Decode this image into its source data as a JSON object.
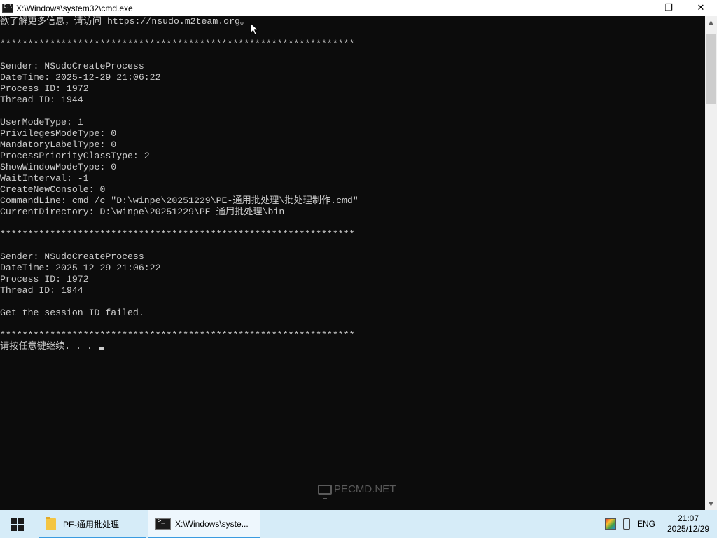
{
  "window": {
    "title": "X:\\Windows\\system32\\cmd.exe",
    "minimize_glyph": "—",
    "restore_glyph": "❐",
    "close_glyph": "✕"
  },
  "console": {
    "lines": [
      "欲了解更多信息，请访问 https://nsudo.m2team.org。",
      "",
      "****************************************************************",
      "",
      "Sender: NSudoCreateProcess",
      "DateTime: 2025-12-29 21:06:22",
      "Process ID: 1972",
      "Thread ID: 1944",
      "",
      "UserModeType: 1",
      "PrivilegesModeType: 0",
      "MandatoryLabelType: 0",
      "ProcessPriorityClassType: 2",
      "ShowWindowModeType: 0",
      "WaitInterval: -1",
      "CreateNewConsole: 0",
      "CommandLine: cmd /c \"D:\\winpe\\20251229\\PE-通用批处理\\批处理制作.cmd\"",
      "CurrentDirectory: D:\\winpe\\20251229\\PE-通用批处理\\bin",
      "",
      "****************************************************************",
      "",
      "Sender: NSudoCreateProcess",
      "DateTime: 2025-12-29 21:06:22",
      "Process ID: 1972",
      "Thread ID: 1944",
      "",
      "Get the session ID failed.",
      "",
      "****************************************************************",
      "请按任意键继续. . . "
    ]
  },
  "watermark": {
    "text": "PECMD.NET"
  },
  "taskbar": {
    "items": [
      {
        "label": "PE-通用批处理",
        "icon": "folder-icon"
      },
      {
        "label": "X:\\Windows\\syste...",
        "icon": "cmd-icon"
      }
    ],
    "tray": {
      "language": "ENG",
      "time": "21:07",
      "date": "2025/12/29"
    }
  },
  "colors": {
    "console_bg": "#0c0c0c",
    "console_fg": "#cccccc",
    "taskbar_bg": "#d6ecf8",
    "taskbar_accent": "#3a9be0"
  }
}
